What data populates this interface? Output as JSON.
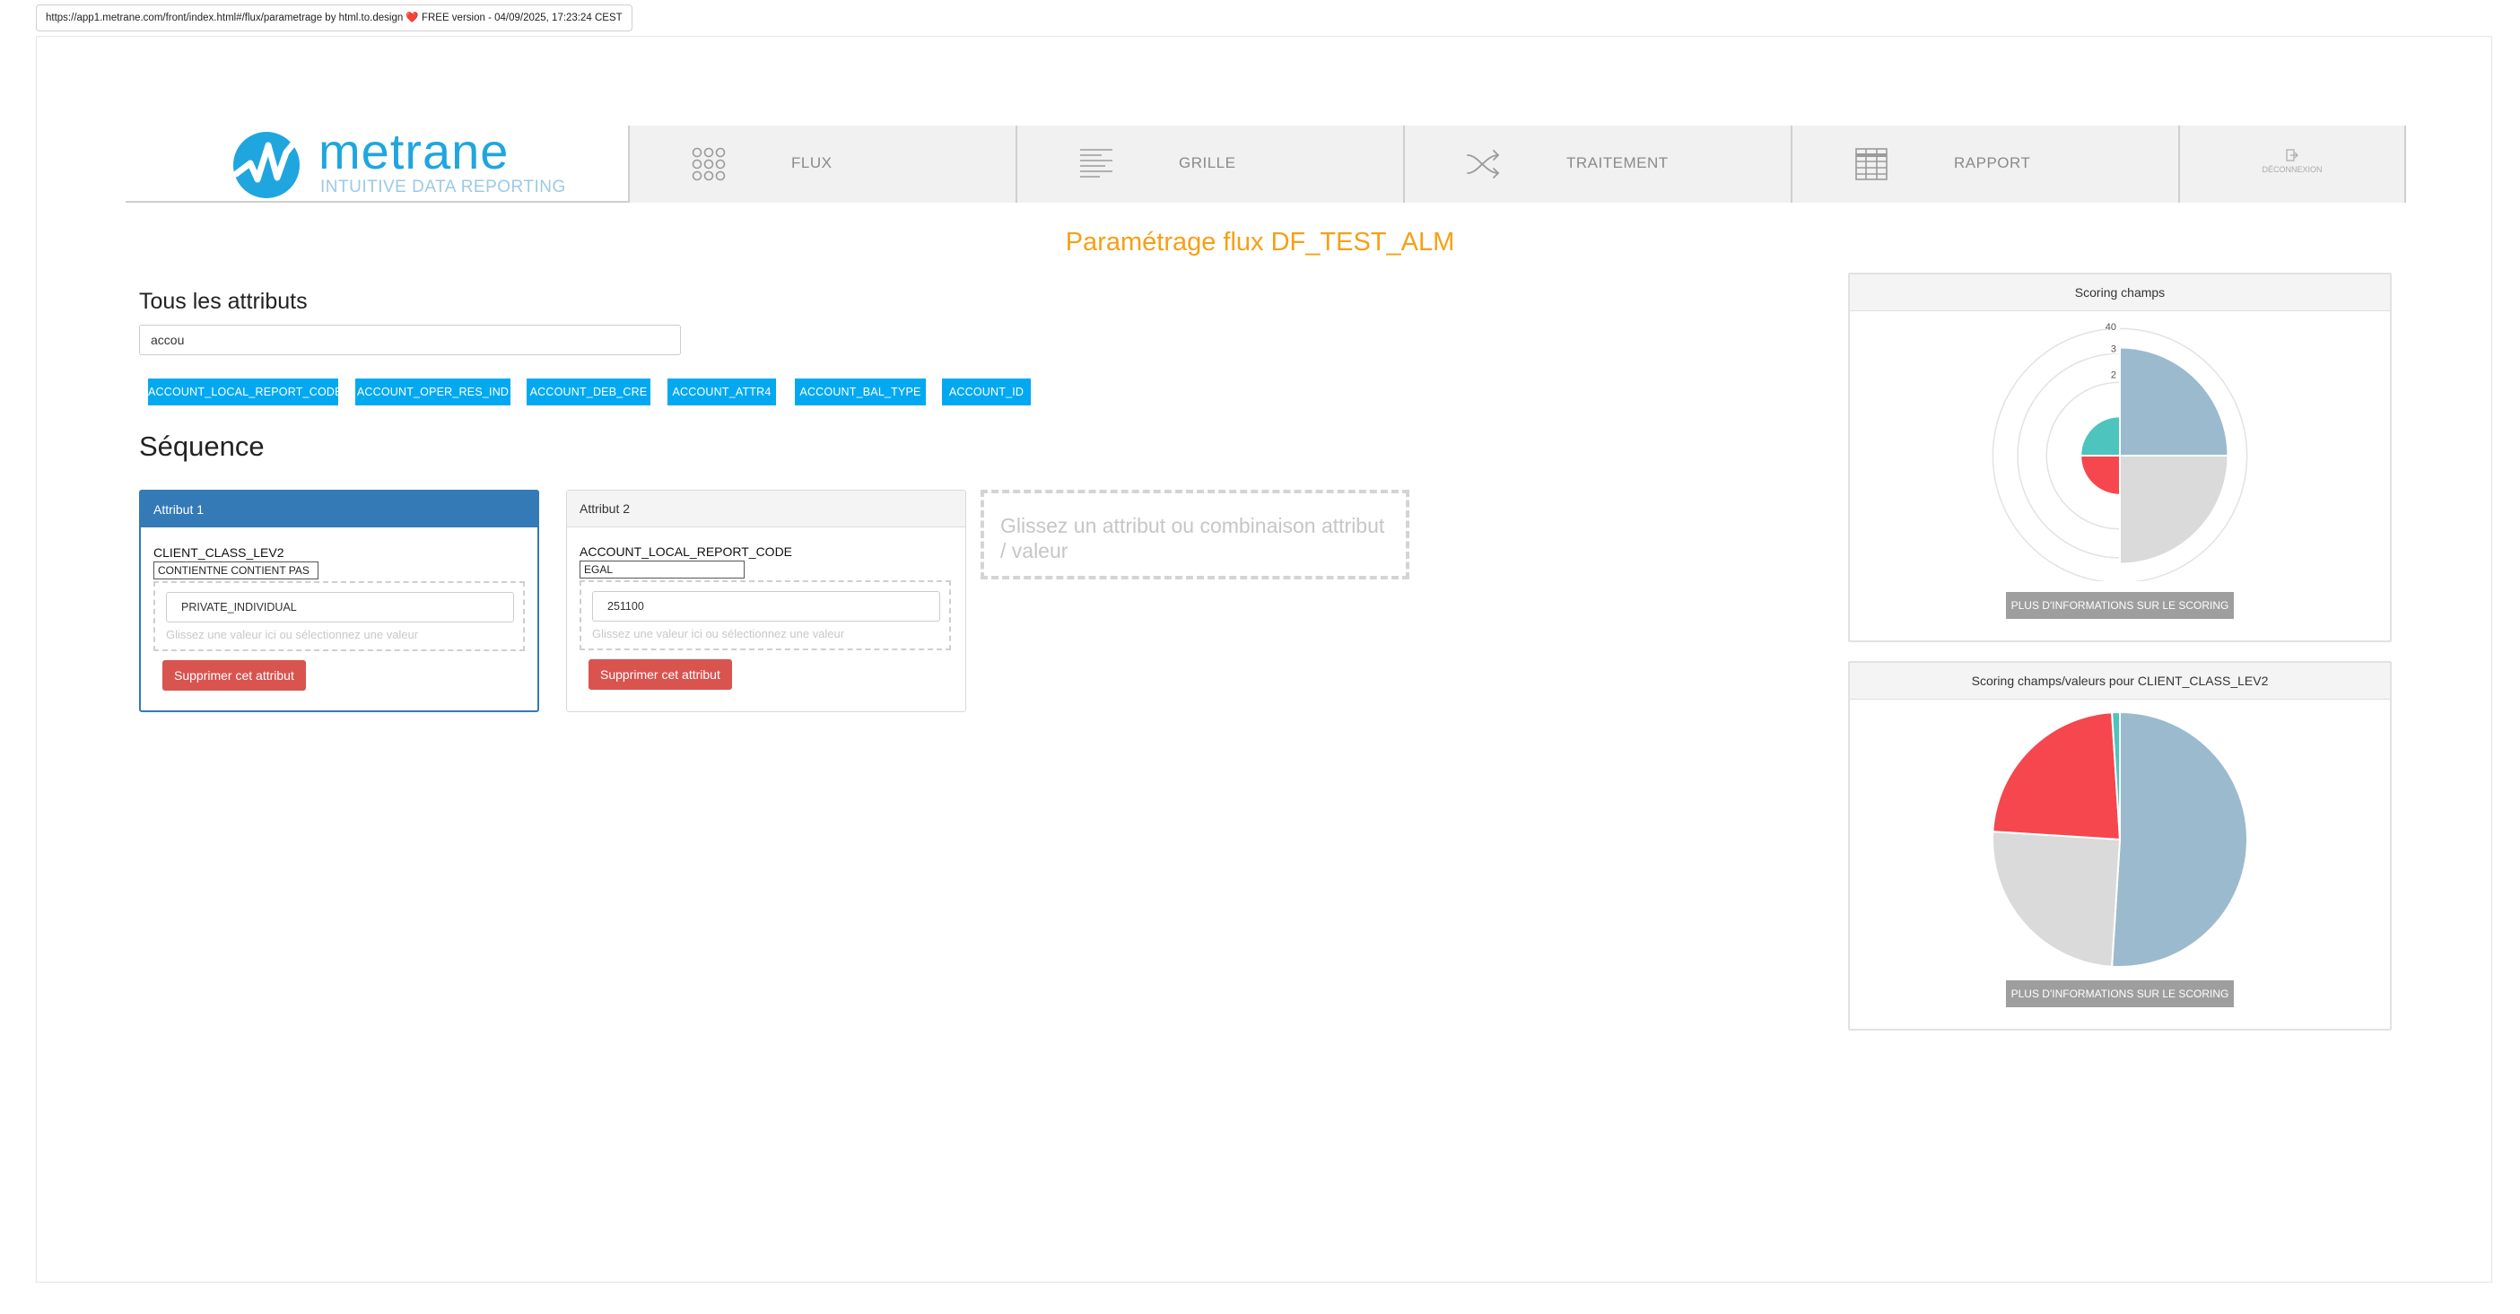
{
  "browser": {
    "url_line": "https://app1.metrane.com/front/index.html#/flux/parametrage by html.to.design ❤️ FREE version - 04/09/2025, 17:23:24 CEST"
  },
  "logo": {
    "word": "metrane",
    "tagline": "INTUITIVE DATA REPORTING"
  },
  "nav": {
    "items": [
      {
        "label": "FLUX",
        "icon": "flux-grid-icon"
      },
      {
        "label": "GRILLE",
        "icon": "grid-lines-icon"
      },
      {
        "label": "TRAITEMENT",
        "icon": "shuffle-icon"
      },
      {
        "label": "RAPPORT",
        "icon": "table-icon"
      }
    ],
    "logout": {
      "label": "DÉCONNEXION",
      "icon": "logout-icon"
    }
  },
  "page_title": "Paramétrage flux DF_TEST_ALM",
  "attributes": {
    "heading": "Tous les attributs",
    "search_value": "accou",
    "chips": [
      "ACCOUNT_LOCAL_REPORT_CODE",
      "ACCOUNT_OPER_RES_IND",
      "ACCOUNT_DEB_CRE",
      "ACCOUNT_ATTR4",
      "ACCOUNT_BAL_TYPE",
      "ACCOUNT_ID"
    ]
  },
  "sequence": {
    "heading": "Séquence",
    "cards": [
      {
        "title": "Attribut 1",
        "attr_name": "CLIENT_CLASS_LEV2",
        "operator": "CONTIENTNE CONTIENT PAS",
        "value": "PRIVATE_INDIVIDUAL",
        "drop_hint": "Glissez une valeur ici ou sélectionnez une valeur",
        "delete_label": "Supprimer cet attribut"
      },
      {
        "title": "Attribut 2",
        "attr_name": "ACCOUNT_LOCAL_REPORT_CODE",
        "operator": "EGAL",
        "value": "251100",
        "drop_hint": "Glissez une valeur ici ou sélectionnez une valeur",
        "delete_label": "Supprimer cet attribut"
      }
    ],
    "drop_text": "Glissez un attribut ou combinaison attribut / valeur"
  },
  "colors": {
    "accent_orange": "#f5a016",
    "chip_blue": "#03a9f0",
    "primary_blue": "#337ab7",
    "danger_red": "#d9534f",
    "slice_blue": "#9bbacd",
    "slice_gray": "#dadada",
    "slice_red": "#f5474d",
    "slice_teal": "#4dc4bd"
  },
  "scoring": {
    "panel1_title": "Scoring champs",
    "panel2_title": "Scoring champs/valeurs pour CLIENT_CLASS_LEV2",
    "more_label": "PLUS D'INFORMATIONS SUR LE SCORING"
  },
  "chart_data": [
    {
      "type": "polar-area",
      "title": "Scoring champs",
      "tick_labels": [
        "2",
        "3",
        "40"
      ],
      "r_max": 40,
      "slices": [
        {
          "value": 33,
          "color": "#9bbacd"
        },
        {
          "value": 33,
          "color": "#dadada"
        },
        {
          "value": 12,
          "color": "#f5474d"
        },
        {
          "value": 12,
          "color": "#4dc4bd"
        }
      ]
    },
    {
      "type": "pie",
      "title": "Scoring champs/valeurs pour CLIENT_CLASS_LEV2",
      "slices": [
        {
          "value": 51,
          "color": "#9bbacd"
        },
        {
          "value": 25,
          "color": "#dadada"
        },
        {
          "value": 23,
          "color": "#f5474d"
        },
        {
          "value": 1,
          "color": "#4dc4bd"
        }
      ]
    }
  ]
}
